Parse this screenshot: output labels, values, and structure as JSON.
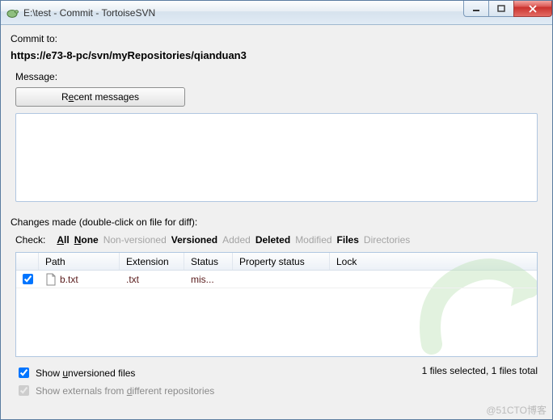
{
  "titlebar": {
    "title": "E:\\test - Commit - TortoiseSVN"
  },
  "commit_to_label": "Commit to:",
  "url": "https://e73-8-pc/svn/myRepositories/qianduan3",
  "message_label": "Message:",
  "recent_btn": {
    "pre": "R",
    "u": "e",
    "post": "cent messages"
  },
  "message_text": "",
  "changes_label": "Changes made (double-click on file for diff):",
  "check_label": "Check:",
  "check_options": {
    "all": {
      "u": "A",
      "post": "ll"
    },
    "none": {
      "u": "N",
      "post": "one"
    },
    "nonversioned": "Non-versioned",
    "versioned": "Versioned",
    "added": "Added",
    "deleted": "Deleted",
    "modified": "Modified",
    "files": "Files",
    "directories": "Directories"
  },
  "columns": {
    "path": "Path",
    "extension": "Extension",
    "status": "Status",
    "property": "Property status",
    "lock": "Lock"
  },
  "rows": [
    {
      "checked": true,
      "path": "b.txt",
      "ext": ".txt",
      "status": "mis..."
    }
  ],
  "show_unversioned": {
    "pre": "Show ",
    "u": "u",
    "post": "nversioned files"
  },
  "show_externals": {
    "pre": "Show externals from ",
    "u": "d",
    "post": "ifferent repositories"
  },
  "status_text": "1 files selected, 1 files total",
  "watermark": "@51CTO博客"
}
